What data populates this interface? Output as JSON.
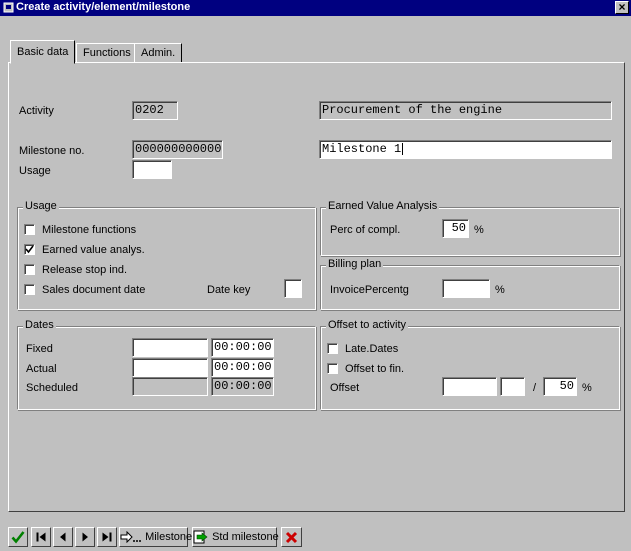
{
  "window": {
    "title": "Create activity/element/milestone",
    "close_label": "×"
  },
  "tabs": [
    {
      "label": "Basic data",
      "active": true
    },
    {
      "label": "Functions",
      "active": false
    },
    {
      "label": "Admin.",
      "active": false
    }
  ],
  "header": {
    "activity_label": "Activity",
    "activity_value": "0202",
    "activity_desc": "Procurement of the engine",
    "milestone_label": "Milestone no.",
    "milestone_value": "000000000000",
    "milestone_desc": "Milestone 1",
    "usage_label": "Usage",
    "usage_value": ""
  },
  "usage_group": {
    "title": "Usage",
    "items": [
      {
        "label": "Milestone functions",
        "checked": false
      },
      {
        "label": "Earned value analys.",
        "checked": true
      },
      {
        "label": "Release stop ind.",
        "checked": false
      },
      {
        "label": "Sales document date",
        "checked": false
      }
    ],
    "date_key_label": "Date key",
    "date_key_value": ""
  },
  "eva_group": {
    "title": "Earned Value Analysis",
    "perc_label": "Perc of compl.",
    "perc_value": "50",
    "perc_unit": "%"
  },
  "billing_group": {
    "title": "Billing plan",
    "invoice_label": "InvoicePercentg",
    "invoice_value": "",
    "invoice_unit": "%"
  },
  "dates_group": {
    "title": "Dates",
    "fixed_label": "Fixed",
    "fixed_date": "",
    "fixed_time": "00:00:00",
    "actual_label": "Actual",
    "actual_date": "",
    "actual_time": "00:00:00",
    "scheduled_label": "Scheduled",
    "scheduled_date": "",
    "scheduled_time": "00:00:00"
  },
  "offset_group": {
    "title": "Offset to activity",
    "late_dates_label": "Late.Dates",
    "late_dates_checked": false,
    "offset_fin_label": "Offset to fin.",
    "offset_fin_checked": false,
    "offset_label": "Offset",
    "offset_value": "",
    "offset_unit_value": "",
    "slash": "/",
    "offset_percent": "50",
    "offset_percent_unit": "%"
  },
  "toolbar": {
    "milestone_label": "Milestone",
    "std_milestone_label": "Std milestone"
  },
  "colors": {
    "titlebar": "#000080",
    "background": "#c0c0c0",
    "enter_green": "#008000",
    "cancel_red": "#cc0000"
  }
}
